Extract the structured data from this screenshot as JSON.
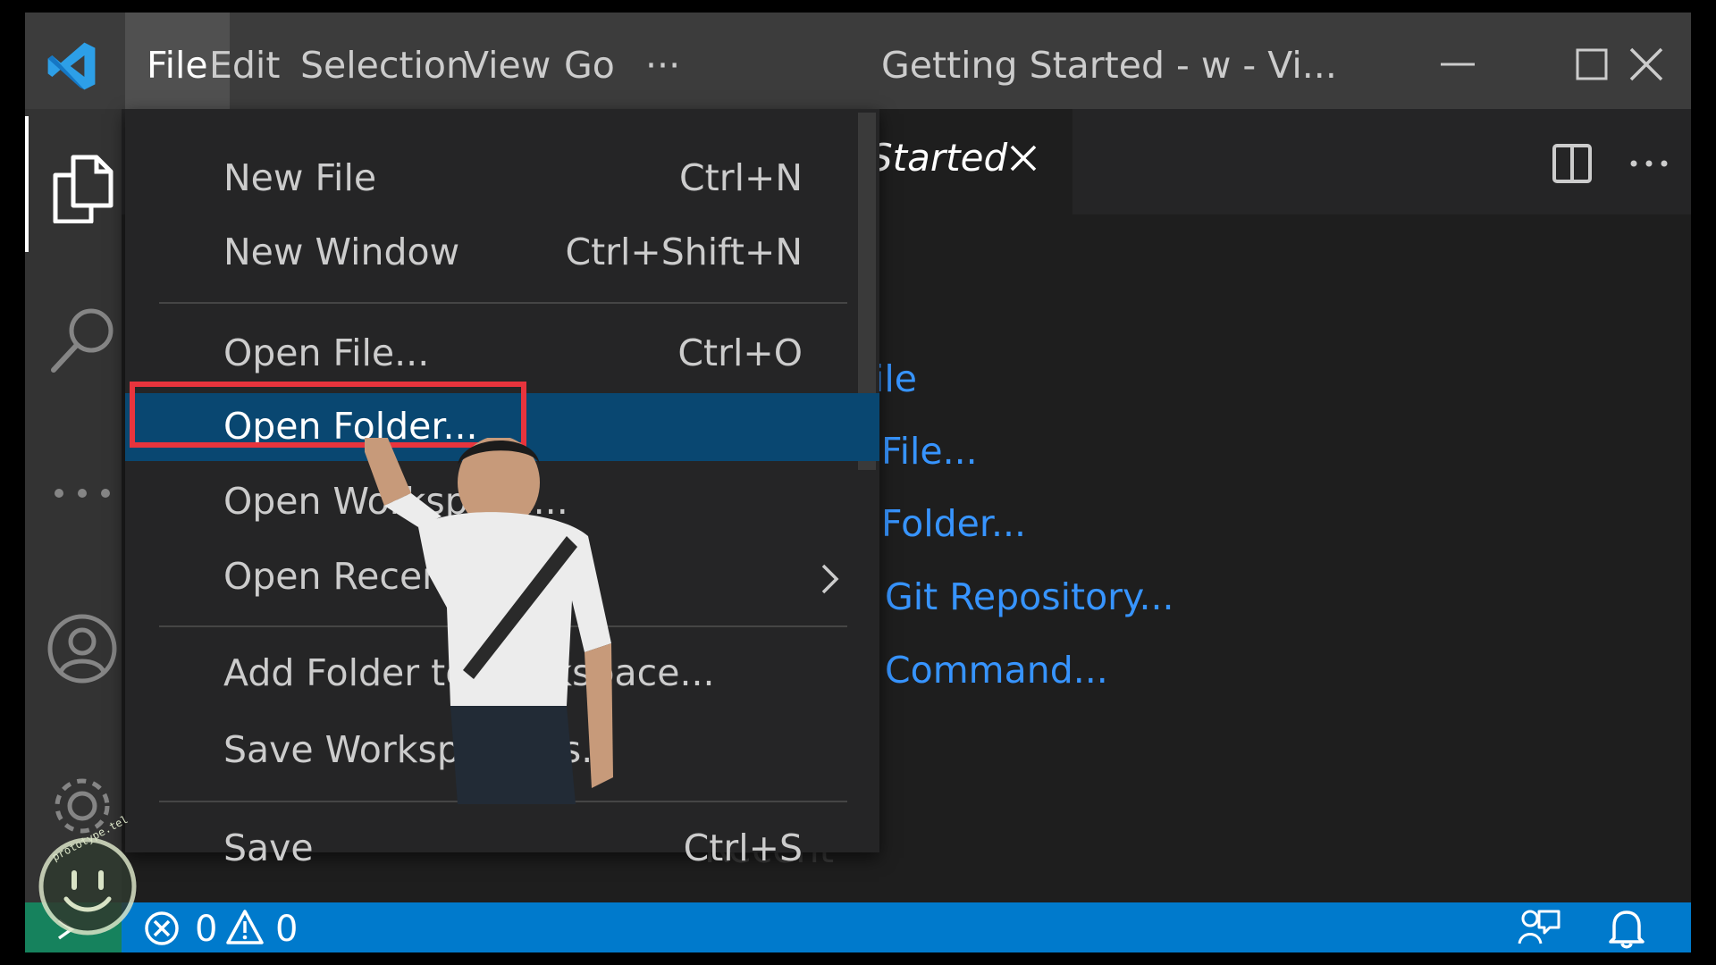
{
  "titlebar": {
    "menu": [
      "File",
      "Edit",
      "Selection",
      "View",
      "Go",
      "···"
    ],
    "window_title": "Getting Started - w - Vi..."
  },
  "tab": {
    "label": "Started"
  },
  "file_menu": {
    "items": [
      {
        "label": "New File",
        "shortcut": "Ctrl+N"
      },
      {
        "label": "New Window",
        "shortcut": "Ctrl+Shift+N"
      },
      {
        "label": "Open File...",
        "shortcut": "Ctrl+O"
      },
      {
        "label": "Open Folder...",
        "shortcut": ""
      },
      {
        "label": "Open Workspace...",
        "shortcut": ""
      },
      {
        "label": "Open Recent",
        "shortcut": ""
      },
      {
        "label": "Add Folder to Workspace...",
        "shortcut": ""
      },
      {
        "label": "Save Workspace As...",
        "shortcut": ""
      },
      {
        "label": "Save",
        "shortcut": "Ctrl+S"
      }
    ],
    "selected_index": 3
  },
  "welcome": {
    "links": [
      "ile",
      "File...",
      "Folder...",
      "Git Repository...",
      "Command..."
    ],
    "section_heading": "Recent"
  },
  "statusbar": {
    "errors": "0",
    "warnings": "0"
  },
  "watermark": {
    "text": "prototype.tel"
  },
  "colors": {
    "titlebar": "#3c3c3c",
    "activitybar": "#333333",
    "editor": "#1e1e1e",
    "menu_bg": "#252526",
    "menu_selected": "#094771",
    "link": "#3794ff",
    "statusbar": "#007acc",
    "remote": "#16825d",
    "highlight_border": "#e8343d"
  },
  "icons": {
    "logo": "vscode-logo-icon",
    "explorer": "files-icon",
    "search": "search-icon",
    "more": "ellipsis-icon",
    "accounts": "account-icon",
    "settings": "gear-icon",
    "split": "split-editor-icon",
    "close": "close-icon",
    "errors": "error-icon",
    "warnings": "warning-icon",
    "feedback": "feedback-icon",
    "notifications": "bell-icon"
  }
}
